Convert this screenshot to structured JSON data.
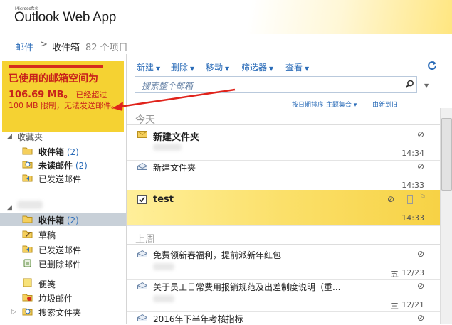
{
  "app": {
    "brand_small": "Microsoft®",
    "brand": "Outlook Web App"
  },
  "breadcrumb": {
    "mail": "邮件",
    "separator": ">",
    "folder": "收件箱",
    "count": "82 个项目"
  },
  "quota": {
    "line1": "已使用的邮箱空间为",
    "line2_big": "106.69 MB。",
    "line2_small": "已经超过",
    "line3": "100 MB 限制，无法发送邮件。"
  },
  "favorites": {
    "title": "收藏夹",
    "items": [
      {
        "label": "收件箱",
        "count": "(2)",
        "bold": true
      },
      {
        "label": "未读邮件",
        "count": "(2)",
        "bold": true
      },
      {
        "label": "已发送邮件",
        "count": "",
        "bold": false
      }
    ]
  },
  "mailbox": {
    "items": [
      {
        "label": "收件箱",
        "count": "(2)",
        "bold": true
      },
      {
        "label": "草稿",
        "count": "",
        "bold": false
      },
      {
        "label": "已发送邮件",
        "count": "",
        "bold": false
      },
      {
        "label": "已删除邮件",
        "count": "",
        "bold": false
      },
      {
        "label": "便笺",
        "count": "",
        "bold": false
      },
      {
        "label": "垃圾邮件",
        "count": "",
        "bold": false
      },
      {
        "label": "搜索文件夹",
        "count": "",
        "bold": false
      }
    ]
  },
  "toolbar": {
    "new": "新建",
    "delete": "删除",
    "move": "移动",
    "filter": "筛选器",
    "view": "查看",
    "search_placeholder": "搜索整个邮箱",
    "sort_label": "按日期排序 主题集合",
    "sort_order": "由新到旧"
  },
  "groups": {
    "today": "今天",
    "last_week": "上周"
  },
  "messages": [
    {
      "subject": "新建文件夹",
      "time": "14:34",
      "bold": true
    },
    {
      "subject": "新建文件夹",
      "time": "14:33",
      "bold": false
    },
    {
      "subject": "test",
      "time": "14:33",
      "bold": true
    },
    {
      "subject": "免费领新春福利，提前派新年红包",
      "day": "五",
      "time": "12/23",
      "bold": false
    },
    {
      "subject": "关于员工日常费用报销规范及出差制度说明（重...",
      "day": "三",
      "time": "12/21",
      "bold": false
    },
    {
      "subject": "2016年下半年考核指标",
      "time": "",
      "bold": false
    }
  ],
  "colors": {
    "accent": "#2b6cb8",
    "quota_bg": "#f5d232",
    "warning": "#c8221b",
    "selected": "#fbe06a"
  }
}
